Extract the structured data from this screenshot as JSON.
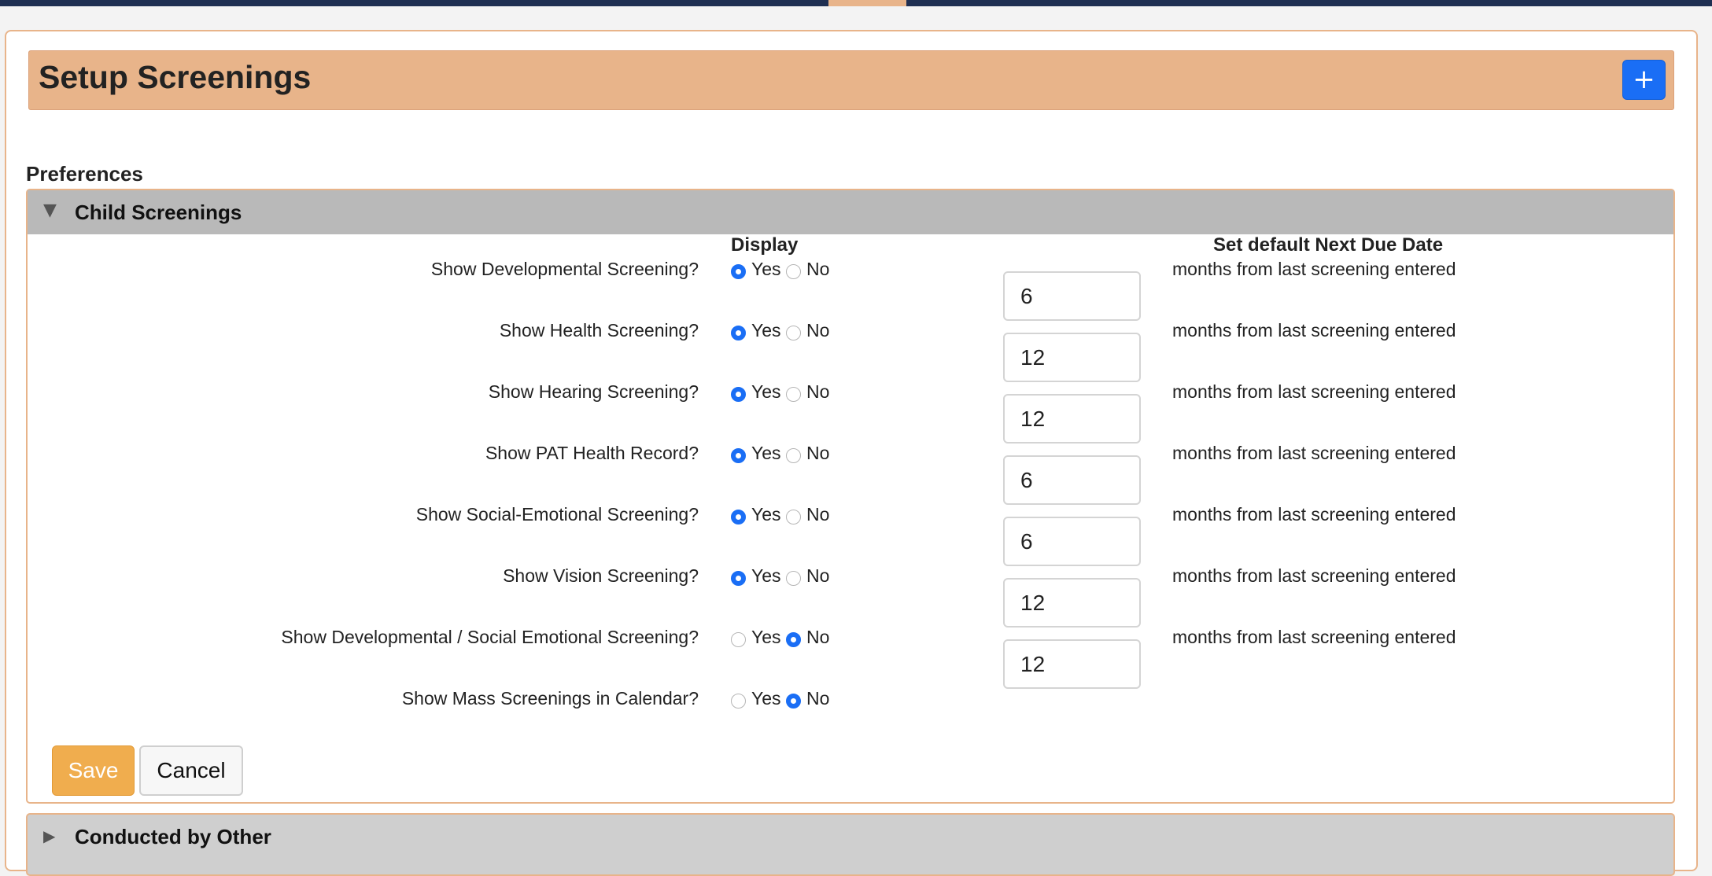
{
  "page": {
    "title": "Setup Screenings",
    "add_icon": "+"
  },
  "preferences_label": "Preferences",
  "section": {
    "title": "Child Screenings",
    "caret": "▼",
    "col_display": "Display",
    "col_due": "Set default Next Due Date",
    "yes_label": "Yes",
    "no_label": "No",
    "rows": [
      {
        "label": "Show Developmental Screening?",
        "display": "Yes",
        "months": "6",
        "suffix": "months from last screening entered"
      },
      {
        "label": "Show Health Screening?",
        "display": "Yes",
        "months": "12",
        "suffix": "months from last screening entered"
      },
      {
        "label": "Show Hearing Screening?",
        "display": "Yes",
        "months": "12",
        "suffix": "months from last screening entered"
      },
      {
        "label": "Show PAT Health Record?",
        "display": "Yes",
        "months": "6",
        "suffix": "months from last screening entered"
      },
      {
        "label": "Show Social-Emotional Screening?",
        "display": "Yes",
        "months": "6",
        "suffix": "months from last screening entered"
      },
      {
        "label": "Show Vision Screening?",
        "display": "Yes",
        "months": "12",
        "suffix": "months from last screening entered"
      },
      {
        "label": "Show Developmental / Social Emotional Screening?",
        "display": "No",
        "months": "12",
        "suffix": "months from last screening entered"
      },
      {
        "label": "Show Mass Screenings in Calendar?",
        "display": "No"
      }
    ],
    "save_label": "Save",
    "cancel_label": "Cancel"
  },
  "section2": {
    "title": "Conducted by Other",
    "caret": "▶"
  },
  "colors": {
    "accent": "#e8b48a",
    "primary": "#1a6ef5",
    "save": "#f0ad4e",
    "topbar": "#1f2f52"
  }
}
